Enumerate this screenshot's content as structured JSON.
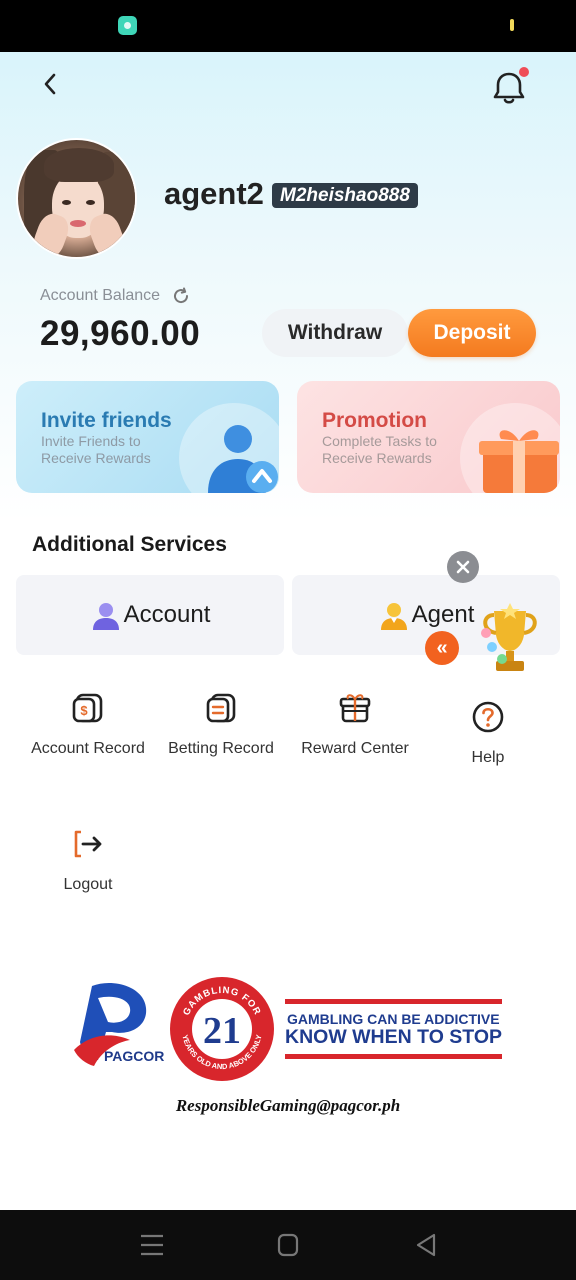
{
  "profile": {
    "username": "agent2",
    "user_code": "M2heishao888"
  },
  "balance": {
    "label": "Account Balance",
    "amount": "29,960.00"
  },
  "actions": {
    "withdraw": "Withdraw",
    "deposit": "Deposit"
  },
  "cards": {
    "invite": {
      "title": "Invite friends",
      "subtitle": "Invite Friends to Receive Rewards"
    },
    "promotion": {
      "title": "Promotion",
      "subtitle": "Complete Tasks to Receive Rewards"
    }
  },
  "services": {
    "title": "Additional Services",
    "account": "Account",
    "agent": "Agent"
  },
  "floating": {
    "collapse_glyph": "«"
  },
  "menu": [
    {
      "label": "Account Record",
      "icon": "dollar-card-icon"
    },
    {
      "label": "Betting Record",
      "icon": "list-card-icon"
    },
    {
      "label": "Reward Center",
      "icon": "gift-icon"
    },
    {
      "label": "Help",
      "icon": "question-icon"
    },
    {
      "label": "Logout",
      "icon": "logout-icon"
    }
  ],
  "footer": {
    "pagcor": "PAGCOR",
    "age_top": "GAMBLING FOR",
    "age_number": "21",
    "age_bottom": "YEARS OLD AND ABOVE ONLY",
    "warning_line1": "GAMBLING CAN BE ADDICTIVE",
    "warning_line2": "KNOW WHEN TO STOP",
    "email": "ResponsibleGaming@pagcor.ph"
  },
  "colors": {
    "accent_orange": "#f47a1f",
    "invite_blue": "#2a7bb2",
    "promo_red": "#d44b46",
    "pagcor_blue": "#1f3c8f",
    "warning_red": "#d8262c"
  }
}
